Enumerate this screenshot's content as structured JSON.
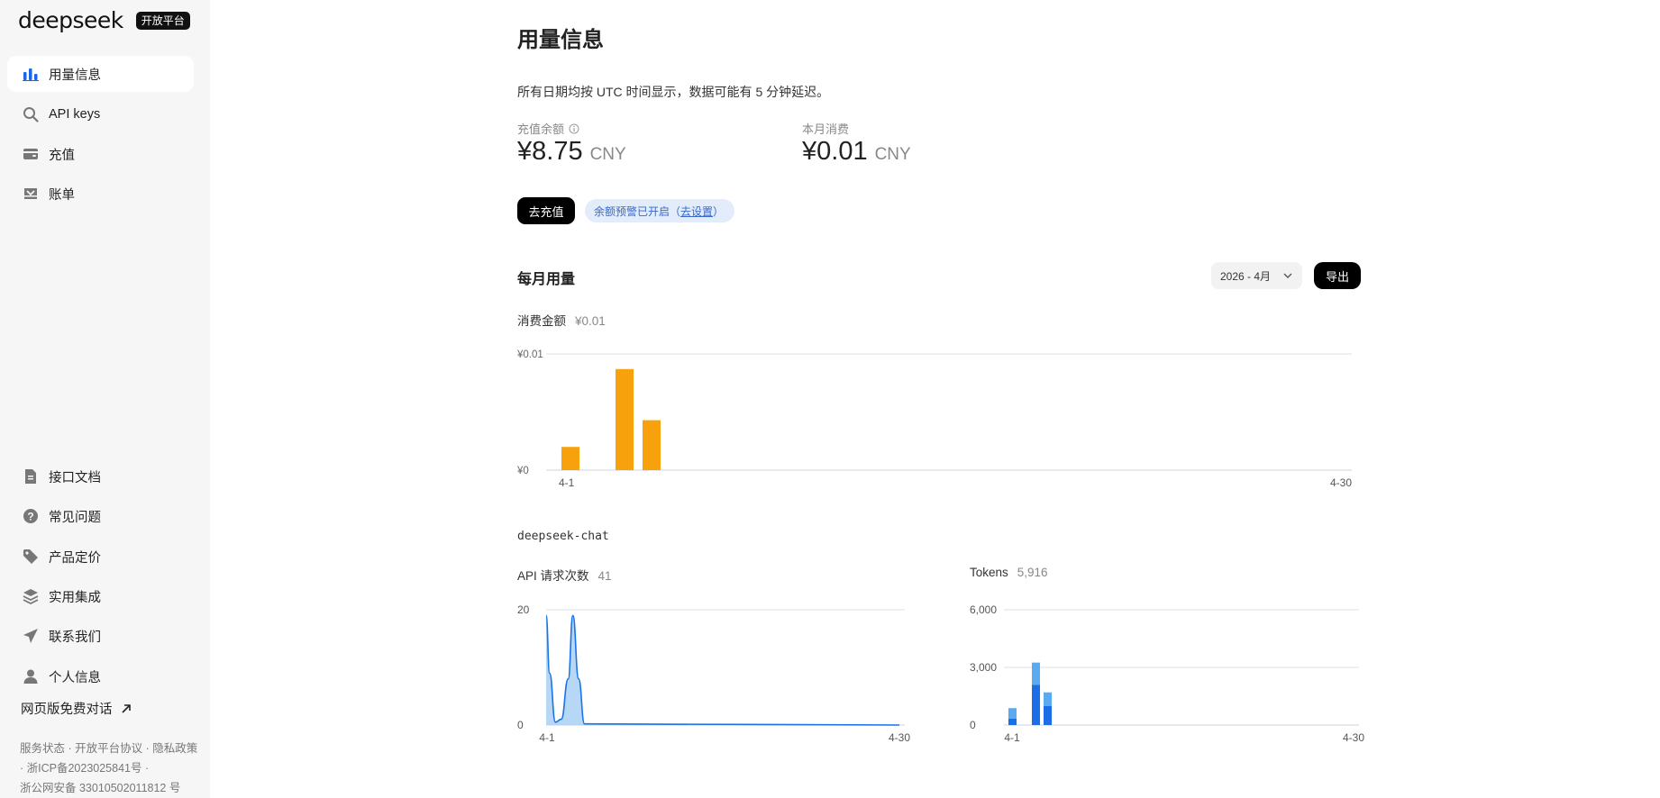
{
  "brand": {
    "logo": "deepseek",
    "badge": "开放平台"
  },
  "sidebar": {
    "top_items": [
      {
        "label": "用量信息",
        "icon": "bar-chart-icon",
        "active": true
      },
      {
        "label": "API keys",
        "icon": "search-icon"
      },
      {
        "label": "充值",
        "icon": "wallet-icon"
      },
      {
        "label": "账单",
        "icon": "inbox-icon"
      }
    ],
    "bottom_items": [
      {
        "label": "接口文档",
        "icon": "document-icon"
      },
      {
        "label": "常见问题",
        "icon": "question-icon"
      },
      {
        "label": "产品定价",
        "icon": "tag-icon"
      },
      {
        "label": "实用集成",
        "icon": "layers-icon"
      },
      {
        "label": "联系我们",
        "icon": "send-icon"
      },
      {
        "label": "个人信息",
        "icon": "user-icon"
      }
    ],
    "web_chat": "网页版免费对话",
    "footer": {
      "line1": "服务状态 · 开放平台协议 · 隐私政策",
      "line2": " · 浙ICP备2023025841号 ·",
      "line3": "浙公网安备 33010502011812 号"
    }
  },
  "main": {
    "title": "用量信息",
    "note": "所有日期均按 UTC 时间显示，数据可能有 5 分钟延迟。",
    "balance": {
      "label": "充值余额",
      "amount": "¥8.75",
      "currency": "CNY"
    },
    "spend": {
      "label": "本月消费",
      "amount": "¥0.01",
      "currency": "CNY"
    },
    "topup_button": "去充值",
    "alert": {
      "text": "余额预警已开启（",
      "link": "去设置",
      "close": "）"
    },
    "monthly_title": "每月用量",
    "month_select": "2026 - 4月",
    "export_button": "导出",
    "cost_chart_label": "消费金额",
    "cost_chart_total": "¥0.01",
    "model_name": "deepseek-chat",
    "requests_label": "API 请求次数",
    "requests_total": "41",
    "tokens_label": "Tokens",
    "tokens_total": "5,916"
  },
  "colors": {
    "accent": "#1a66e6",
    "cost_bar": "#f7a10d",
    "token_dark": "#1b6ee6",
    "token_light": "#5aaaf2",
    "area_fill": "#a9d0f5",
    "line": "#1a73e8"
  },
  "chart_data": [
    {
      "type": "bar",
      "title": "消费金额",
      "x": [
        1,
        2,
        3,
        4,
        5
      ],
      "x_tick_labels": [
        "4-1",
        "4-30"
      ],
      "y_tick_labels": [
        "¥0",
        "¥0.01"
      ],
      "values": [
        0.002,
        0,
        0.0087,
        0.0043,
        0
      ],
      "ylim": [
        0,
        0.01
      ],
      "xlim": [
        1,
        30
      ],
      "grid": true
    },
    {
      "type": "area",
      "title": "API 请求次数",
      "x": [
        1,
        1.3,
        1.8,
        2.3,
        2.9,
        3.3,
        3.8,
        4.3,
        30
      ],
      "values": [
        19,
        9,
        0.5,
        1,
        8,
        19,
        8,
        0.2,
        0
      ],
      "x_tick_labels": [
        "4-1",
        "4-30"
      ],
      "y_tick_labels": [
        "0",
        "20"
      ],
      "ylim": [
        0,
        20
      ],
      "xlim": [
        1,
        30
      ],
      "grid": true
    },
    {
      "type": "bar",
      "title": "Tokens",
      "categories_x": [
        1,
        3,
        4
      ],
      "x_tick_labels": [
        "4-1",
        "4-30"
      ],
      "y_tick_labels": [
        "0",
        "3,000",
        "6,000"
      ],
      "series": [
        {
          "values": [
            330,
            2100,
            1000
          ]
        },
        {
          "values": [
            550,
            1150,
            700
          ]
        }
      ],
      "ylim": [
        0,
        6000
      ],
      "xlim": [
        1,
        30
      ],
      "grid": true
    }
  ]
}
